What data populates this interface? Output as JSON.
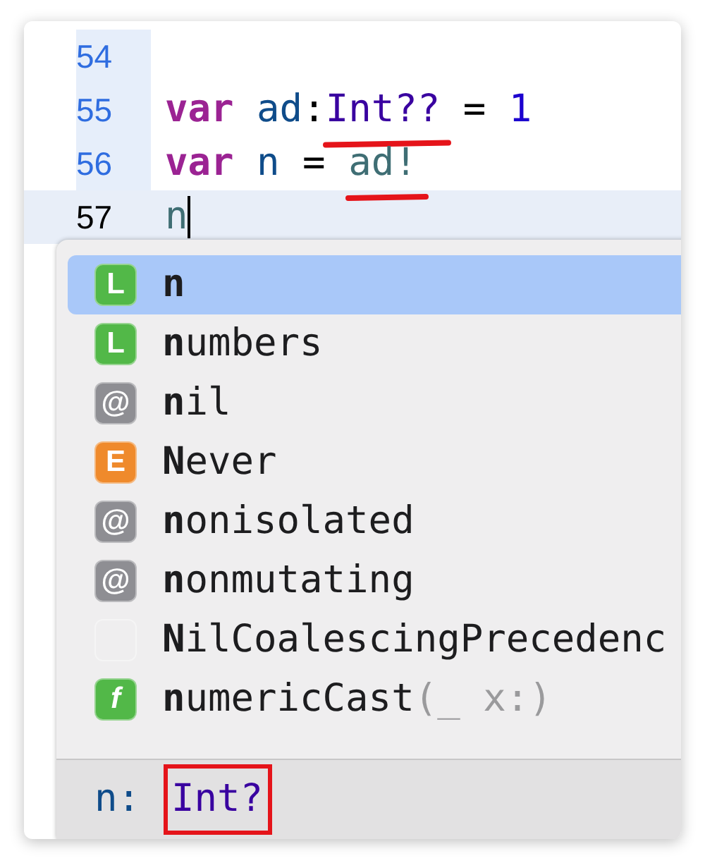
{
  "lines": [
    {
      "number": "54",
      "current": false
    },
    {
      "number": "55",
      "current": false,
      "tokens": [
        {
          "text": "var",
          "kind": "keyword"
        },
        {
          "text": " ad",
          "kind": "identifier"
        },
        {
          "text": ":",
          "kind": "plain"
        },
        {
          "text": "Int??",
          "kind": "type",
          "underlined": true
        },
        {
          "text": " = ",
          "kind": "plain"
        },
        {
          "text": "1",
          "kind": "number"
        }
      ]
    },
    {
      "number": "56",
      "current": false,
      "tokens": [
        {
          "text": "var",
          "kind": "keyword"
        },
        {
          "text": " n",
          "kind": "identifier"
        },
        {
          "text": " = ",
          "kind": "plain"
        },
        {
          "text": "ad!",
          "kind": "variable",
          "underlined": true
        }
      ]
    },
    {
      "number": "57",
      "current": true,
      "tokens": [
        {
          "text": "n",
          "kind": "variable"
        }
      ]
    }
  ],
  "completions": [
    {
      "badge": "L",
      "color": "#52b848",
      "label": "**n**",
      "selected": true
    },
    {
      "badge": "L",
      "color": "#52b848",
      "label": "**n**umbers",
      "selected": false
    },
    {
      "badge": "@",
      "color": "#8e8e93",
      "label": "**n**il",
      "selected": false
    },
    {
      "badge": "E",
      "color": "#ef8a2c",
      "label": "**N**ever",
      "selected": false
    },
    {
      "badge": "@",
      "color": "#8e8e93",
      "label": "**n**onisolated",
      "selected": false
    },
    {
      "badge": "@",
      "color": "#8e8e93",
      "label": "**n**onmutating",
      "selected": false
    },
    {
      "label": "**N**ilCoalescingPrecedenc",
      "selected": false
    },
    {
      "badge": "f",
      "color": "#52b848",
      "label": "**n**umericCast",
      "args": "(_ x:)",
      "selected": false
    }
  ],
  "footer": {
    "name": "n:",
    "type": "Int?",
    "boxed": true
  }
}
